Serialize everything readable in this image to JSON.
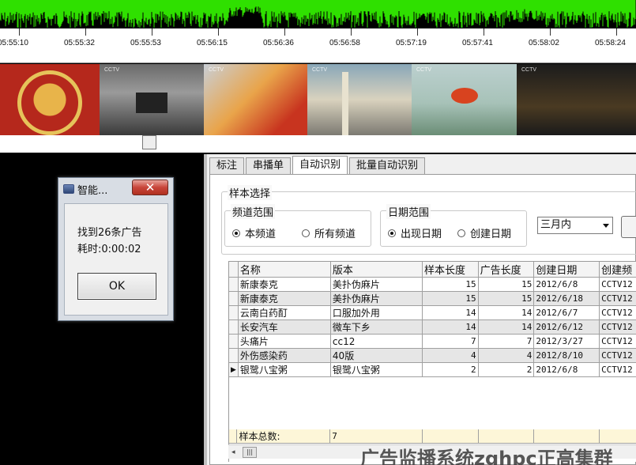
{
  "timeline": {
    "ticks": [
      "05:55:10",
      "05:55:32",
      "05:55:53",
      "05:56:15",
      "05:56:36",
      "05:56:58",
      "05:57:19",
      "05:57:41",
      "05:58:02",
      "05:58:24"
    ]
  },
  "thumbnails": {
    "tag": "CCTV"
  },
  "dialog": {
    "title": "智能...",
    "close_label": "✕",
    "message_line1": "找到26条广告",
    "message_line2": "耗时:0:00:02",
    "ok_label": "OK"
  },
  "tabs": [
    {
      "label": "标注"
    },
    {
      "label": "串播单"
    },
    {
      "label": "自动识别"
    },
    {
      "label": "批量自动识别"
    }
  ],
  "sample_select": {
    "legend": "样本选择",
    "channel_range": {
      "legend": "频道范围",
      "option1": "本频道",
      "option2": "所有频道",
      "selected": "本频道"
    },
    "date_range": {
      "legend": "日期范围",
      "option1": "出现日期",
      "option2": "创建日期",
      "selected": "出现日期"
    },
    "period_select": "三月内"
  },
  "grid": {
    "columns": [
      "名称",
      "版本",
      "样本长度",
      "广告长度",
      "创建日期",
      "创建频"
    ],
    "rows": [
      {
        "name": "新康泰克",
        "version": "美扑伪麻片",
        "sample_len": "15",
        "ad_len": "15",
        "created": "2012/6/8",
        "channel": "CCTV12"
      },
      {
        "name": "新康泰克",
        "version": "美扑伪麻片",
        "sample_len": "15",
        "ad_len": "15",
        "created": "2012/6/18",
        "channel": "CCTV12"
      },
      {
        "name": "云南白药酊",
        "version": "口服加外用",
        "sample_len": "14",
        "ad_len": "14",
        "created": "2012/6/7",
        "channel": "CCTV12"
      },
      {
        "name": "长安汽车",
        "version": "微车下乡",
        "sample_len": "14",
        "ad_len": "14",
        "created": "2012/6/12",
        "channel": "CCTV12"
      },
      {
        "name": "头痛片",
        "version": "cc12",
        "sample_len": "7",
        "ad_len": "7",
        "created": "2012/3/27",
        "channel": "CCTV12"
      },
      {
        "name": "外伤感染药",
        "version": "40版",
        "sample_len": "4",
        "ad_len": "4",
        "created": "2012/8/10",
        "channel": "CCTV12"
      },
      {
        "name": "银鹭八宝粥",
        "version": "银鹭八宝粥",
        "sample_len": "2",
        "ad_len": "2",
        "created": "2012/6/8",
        "channel": "CCTV12"
      }
    ],
    "summary_label": "样本总数:",
    "summary_value": "7",
    "current_row_marker": "▶"
  },
  "watermark": "广告监播系统zghpc正高集群",
  "colors": {
    "waveform": "#2fe000",
    "close_button": "#c8453a",
    "summary_row": "#fdf6d8"
  }
}
